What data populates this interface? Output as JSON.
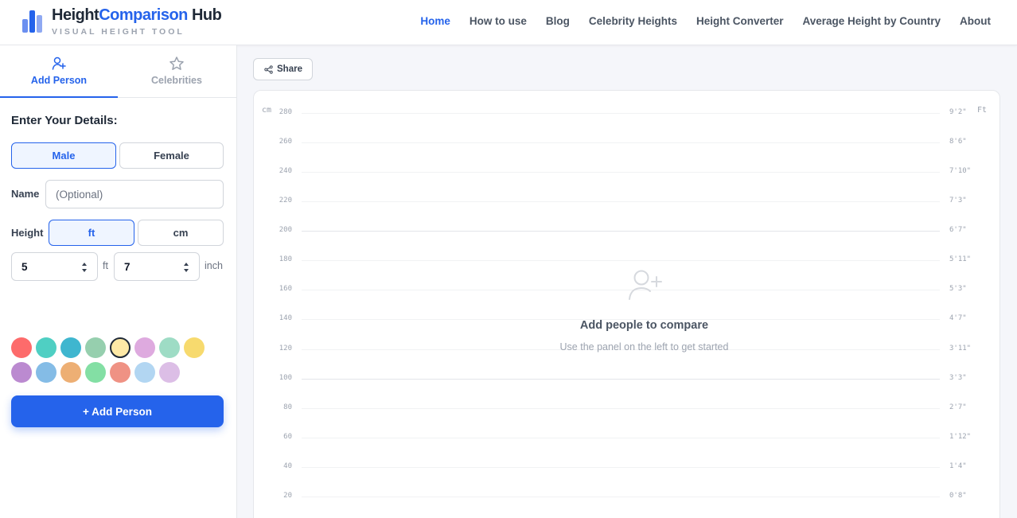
{
  "brand": {
    "title_part1": "Height",
    "title_part2": "Comparison",
    "title_part3": " Hub",
    "subtitle": "VISUAL HEIGHT TOOL",
    "accent": "#2563eb",
    "dark": "#1f2937"
  },
  "nav": {
    "items": [
      {
        "label": "Home",
        "active": true
      },
      {
        "label": "How to use"
      },
      {
        "label": "Blog"
      },
      {
        "label": "Celebrity Heights"
      },
      {
        "label": "Height Converter"
      },
      {
        "label": "Average Height by Country"
      },
      {
        "label": "About"
      }
    ]
  },
  "sidebar": {
    "tabs": [
      {
        "label": "Add Person",
        "icon": "user-plus-icon",
        "active": true
      },
      {
        "label": "Celebrities",
        "icon": "star-icon"
      }
    ],
    "form_title": "Enter Your Details:",
    "gender": {
      "male": "Male",
      "female": "Female",
      "selected": "Male"
    },
    "name_label": "Name",
    "name_placeholder": "(Optional)",
    "name_value": "",
    "height_label": "Height",
    "unit_toggle": {
      "ft": "ft",
      "cm": "cm",
      "selected": "ft"
    },
    "feet_value": "5",
    "feet_unit": "ft",
    "inch_value": "7",
    "inch_unit": "inch",
    "colors": [
      "#fd6b6b",
      "#4fcfc3",
      "#3fb6cf",
      "#96cfae",
      "#fee9a6",
      "#deaadf",
      "#9edcc5",
      "#f7da6e",
      "#bb8ad0",
      "#84bce6",
      "#edaf74",
      "#83dfa4",
      "#ef9284",
      "#b2d6f2",
      "#dcbee6"
    ],
    "selected_color_index": 4,
    "add_button": "+ Add Person"
  },
  "main": {
    "share_label": "Share",
    "unit_left": "cm",
    "unit_right": "Ft",
    "ticks_cm": [
      "280",
      "260",
      "240",
      "220",
      "200",
      "180",
      "160",
      "140",
      "120",
      "100",
      "80",
      "60",
      "40",
      "20"
    ],
    "ticks_ft": [
      "9'2\"",
      "8'6\"",
      "7'10\"",
      "7'3\"",
      "6'7\"",
      "5'11\"",
      "5'3\"",
      "4'7\"",
      "3'11\"",
      "3'3\"",
      "2'7\"",
      "1'12\"",
      "1'4\"",
      "0'8\""
    ],
    "major_ticks": [
      "200",
      "100"
    ],
    "empty_title": "Add people to compare",
    "empty_subtitle": "Use the panel on the left to get started"
  }
}
